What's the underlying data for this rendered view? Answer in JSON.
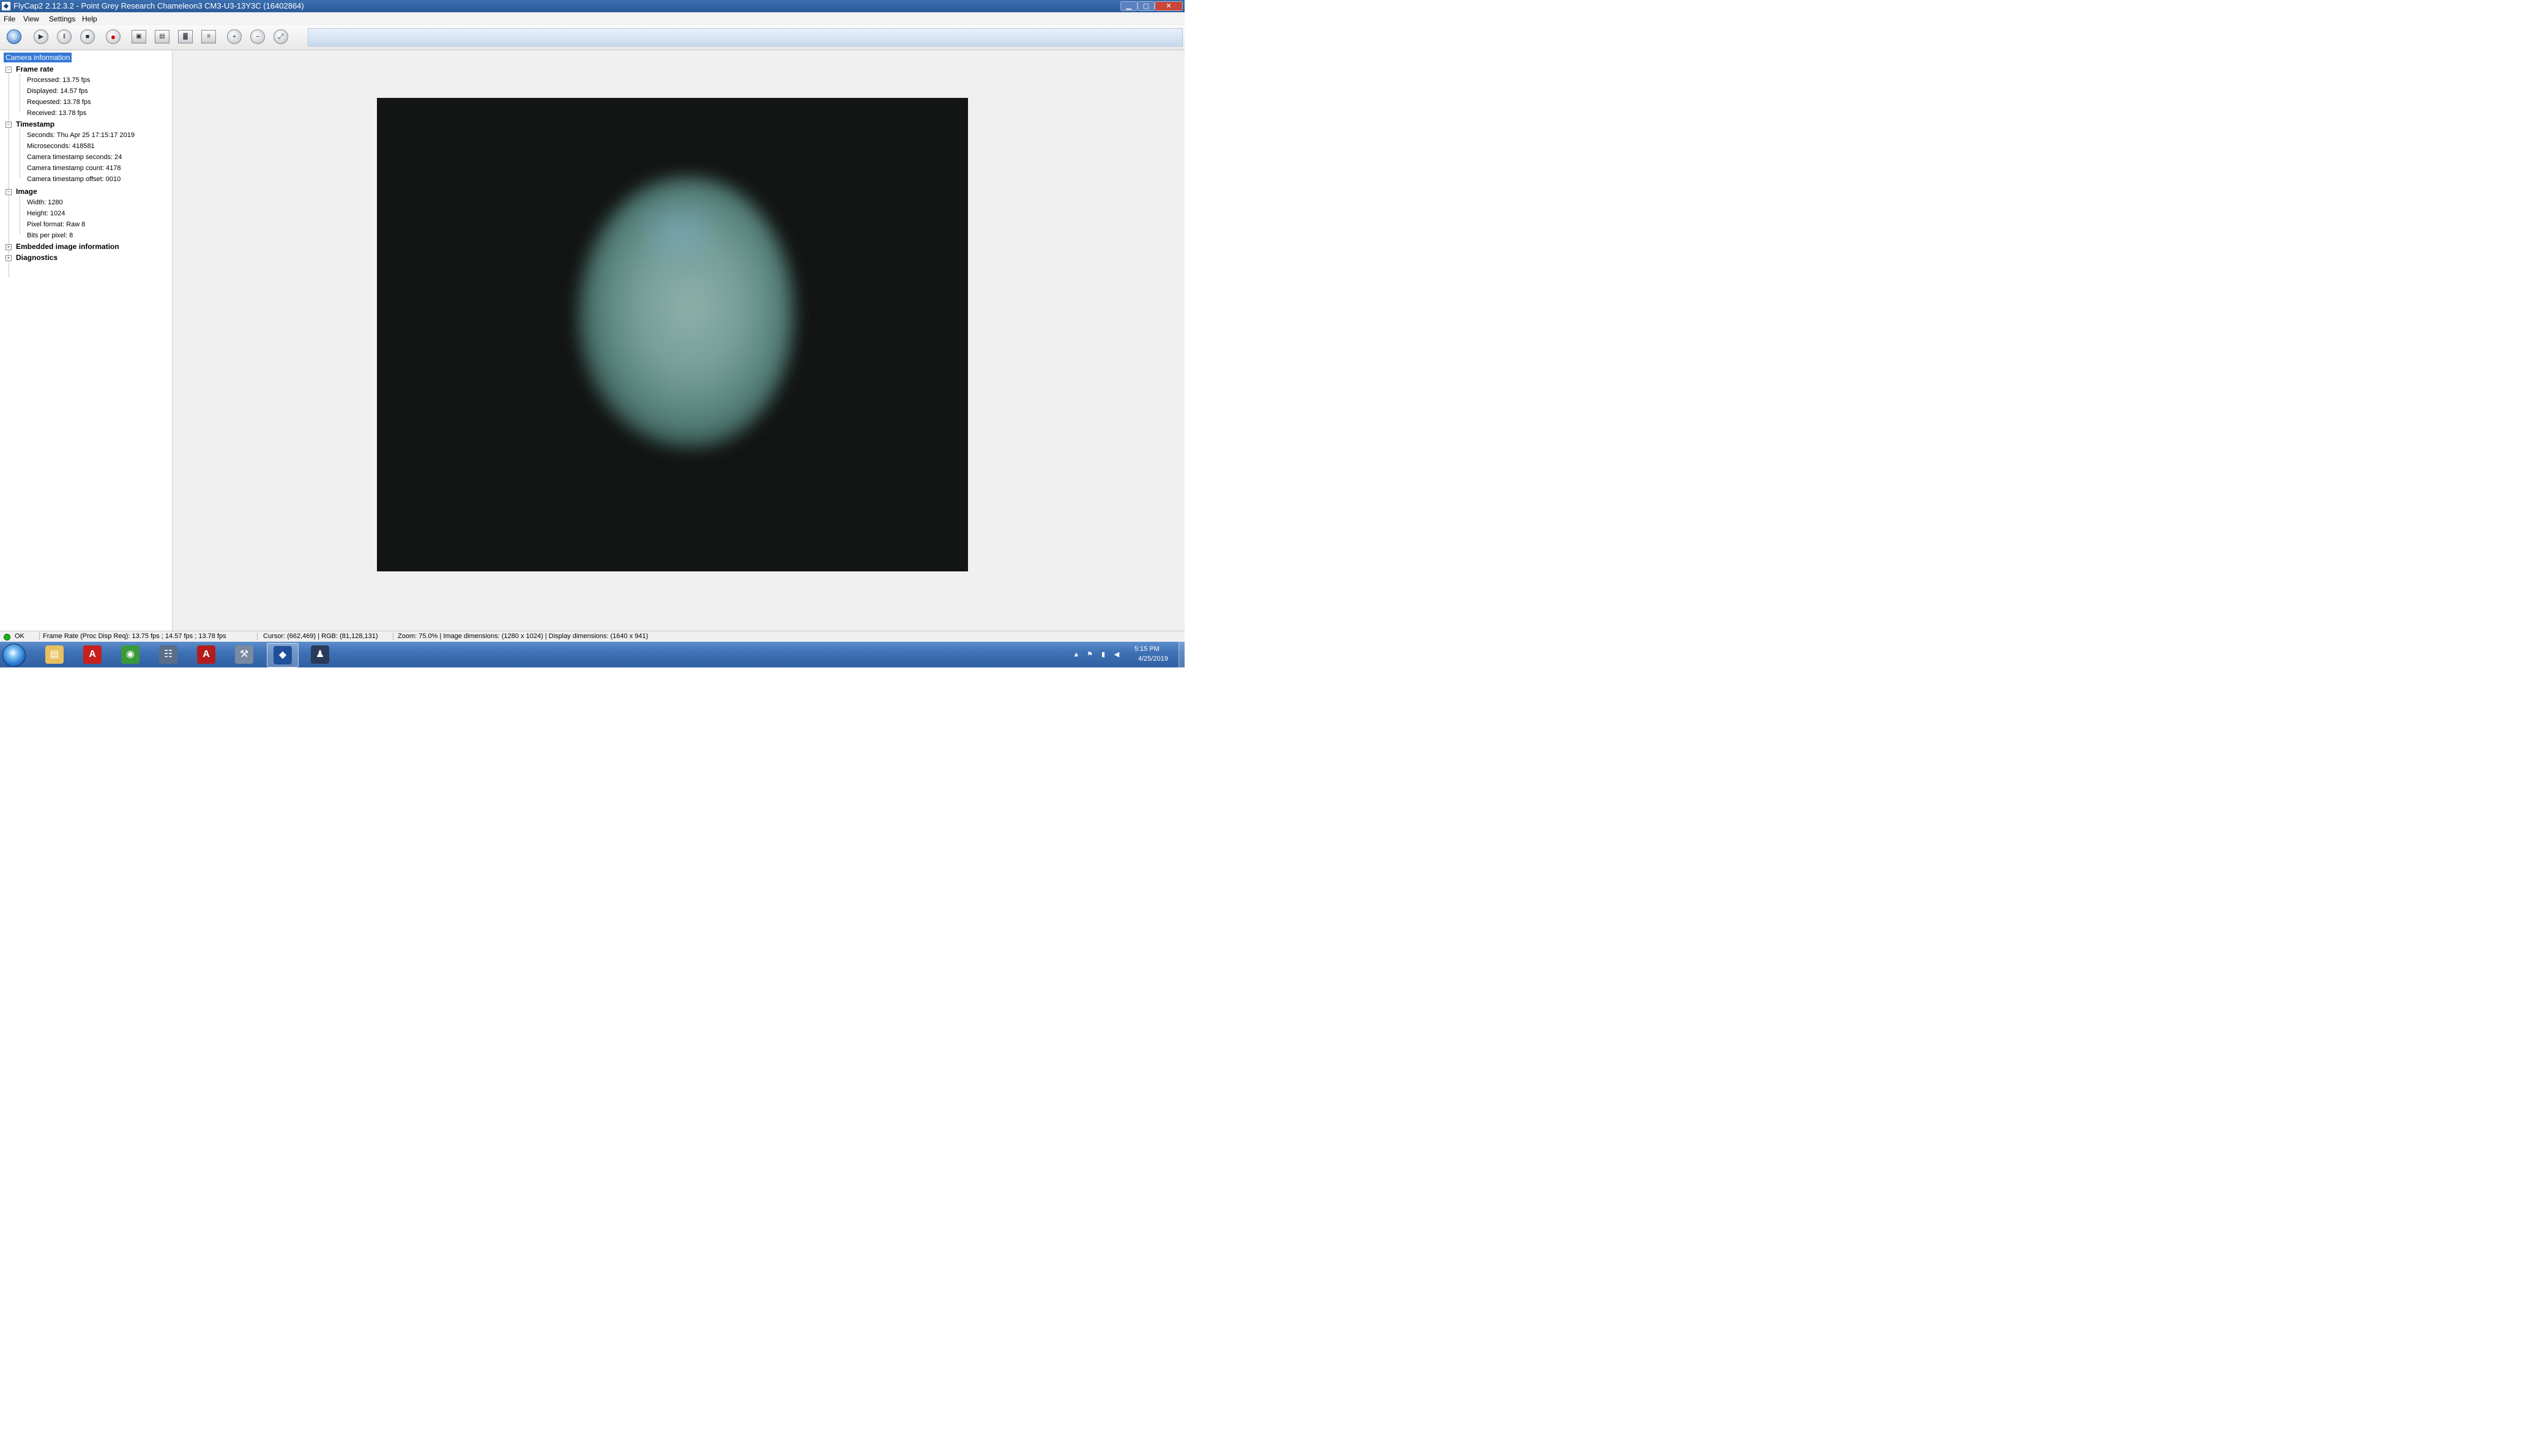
{
  "window": {
    "title": "FlyCap2 2.12.3.2 - Point Grey Research Chameleon3 CM3-U3-13Y3C (16402864)",
    "app_icon": "flycap-icon",
    "minimize_icon": "minimize-icon",
    "maximize_icon": "maximize-icon",
    "close_icon": "close-icon"
  },
  "menu": {
    "items": [
      "File",
      "View",
      "Settings",
      "Help"
    ]
  },
  "toolbar": {
    "buttons": [
      {
        "name": "select-camera",
        "icon": "camera-select-icon",
        "glyph": "◎"
      },
      {
        "name": "start",
        "icon": "play-icon",
        "glyph": "▶"
      },
      {
        "name": "pause",
        "icon": "pause-icon",
        "glyph": "‖"
      },
      {
        "name": "stop",
        "icon": "stop-icon",
        "glyph": "■"
      },
      {
        "name": "record",
        "icon": "record-icon",
        "glyph": "●"
      },
      {
        "name": "save-image",
        "icon": "save-icon",
        "glyph": "▣"
      },
      {
        "name": "camera-control",
        "icon": "camera-control-icon",
        "glyph": "▤"
      },
      {
        "name": "histogram",
        "icon": "histogram-icon",
        "glyph": "▓"
      },
      {
        "name": "event-statistics",
        "icon": "event-stats-icon",
        "glyph": "≡"
      },
      {
        "name": "zoom-in",
        "icon": "zoom-in-icon",
        "glyph": "+"
      },
      {
        "name": "zoom-out",
        "icon": "zoom-out-icon",
        "glyph": "−"
      },
      {
        "name": "zoom-fit",
        "icon": "zoom-fit-icon",
        "glyph": "⤢"
      }
    ]
  },
  "panel": {
    "tab_label": "Camera information",
    "frame_rate": {
      "label": "Frame rate",
      "items": [
        "Processed: 13.75 fps",
        "Displayed: 14.57 fps",
        "Requested: 13.78 fps",
        "Received: 13.78 fps"
      ]
    },
    "timestamp": {
      "label": "Timestamp",
      "items": [
        "Seconds: Thu Apr 25 17:15:17 2019",
        "Microseconds: 418581",
        "Camera timestamp seconds: 24",
        "Camera timestamp count: 4178",
        "Camera timestamp offset: 0010"
      ]
    },
    "image": {
      "label": "Image",
      "items": [
        "Width: 1280",
        "Height: 1024",
        "Pixel format: Raw 8",
        "Bits per pixel: 8"
      ]
    },
    "embedded": {
      "label": "Embedded image information"
    },
    "diagnostics": {
      "label": "Diagnostics"
    },
    "expanded_glyph": "−",
    "collapsed_glyph": "+"
  },
  "status": {
    "ok": "OK",
    "frame_rate": "Frame Rate (Proc Disp Req): 13.75 fps ; 14.57 fps ; 13.78 fps",
    "cursor": "Cursor: (662,469) | RGB: (81,128,131)",
    "zoom": "Zoom: 75.0% | Image dimensions: (1280 x 1024) | Display dimensions: (1640 x 941)",
    "indicator_color": "#1bb31b"
  },
  "taskbar": {
    "apps": [
      {
        "name": "file-explorer",
        "icon": "folder-icon",
        "glyph": "▤",
        "color": "#e8c060"
      },
      {
        "name": "acrobat",
        "icon": "pdf-icon",
        "glyph": "A",
        "color": "#c8201c"
      },
      {
        "name": "chrome",
        "icon": "chrome-icon",
        "glyph": "◉",
        "color": "#3a9a3a"
      },
      {
        "name": "app-4",
        "icon": "app-window-icon",
        "glyph": "☷",
        "color": "#5a6e8a"
      },
      {
        "name": "acrobat-pro",
        "icon": "acrobat-icon",
        "glyph": "A",
        "color": "#b41c1c"
      },
      {
        "name": "app-6",
        "icon": "tools-icon",
        "glyph": "⚒",
        "color": "#7a8aa0"
      },
      {
        "name": "flycap",
        "icon": "flycap-icon",
        "glyph": "◆",
        "color": "#1f4f9a",
        "active": true
      },
      {
        "name": "app-8",
        "icon": "user-icon",
        "glyph": "♟",
        "color": "#2a3a5a"
      }
    ],
    "tray": {
      "time": "5:15 PM",
      "date": "4/25/2019",
      "icons": [
        "show-hidden-icon",
        "flag-icon",
        "network-icon",
        "volume-icon"
      ]
    }
  }
}
